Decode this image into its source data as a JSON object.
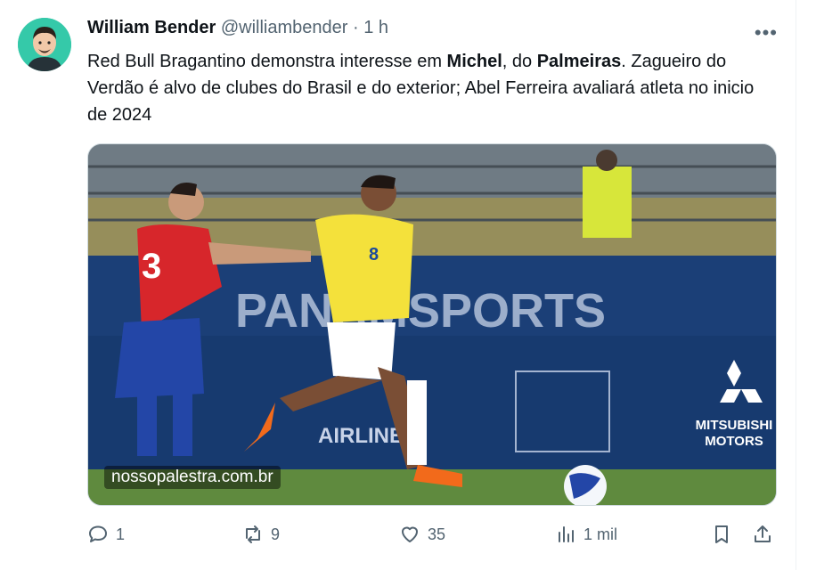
{
  "author": {
    "name": "William Bender",
    "handle": "@williambender",
    "separator": "·",
    "time": "1 h"
  },
  "tweet": {
    "parts": [
      {
        "text": "Red Bull Bragantino demonstra interesse em ",
        "bold": false
      },
      {
        "text": "Michel",
        "bold": true
      },
      {
        "text": ", do ",
        "bold": false
      },
      {
        "text": "Palmeiras",
        "bold": true
      },
      {
        "text": ". Zagueiro do Verdão é alvo de clubes do Brasil e do exterior; Abel Ferreira avaliará atleta no inicio de 2024",
        "bold": false
      }
    ]
  },
  "media": {
    "watermark": "nossopalestra.com.br",
    "banner_text": "PANAMSPORTS",
    "sponsor_1": "AIRLINES",
    "sponsor_2_line1": "MITSUBISHI",
    "sponsor_2_line2": "MOTORS",
    "player_left_number": "8",
    "player_right_number": "3"
  },
  "actions": {
    "replies": "1",
    "reposts": "9",
    "likes": "35",
    "views": "1 mil"
  },
  "colors": {
    "text": "#0f1419",
    "muted": "#536471",
    "brazil_yellow": "#f4e13b",
    "chile_red": "#d7262b"
  }
}
